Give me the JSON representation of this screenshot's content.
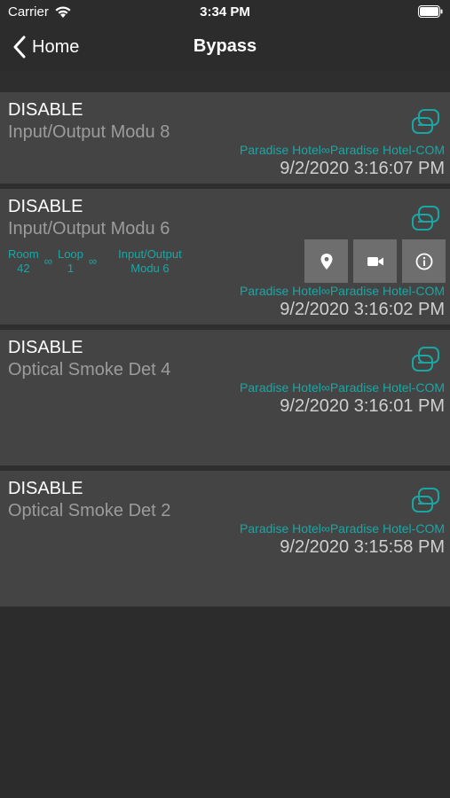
{
  "status_bar": {
    "carrier": "Carrier",
    "time": "3:34 PM"
  },
  "nav": {
    "back_label": "Home",
    "title": "Bypass"
  },
  "items": [
    {
      "status": "DISABLE",
      "device": "Input/Output Modu 8",
      "location": "Paradise Hotel∞Paradise Hotel-COM",
      "timestamp": "9/2/2020 3:16:07 PM"
    },
    {
      "status": "DISABLE",
      "device": "Input/Output Modu 6",
      "location": "Paradise Hotel∞Paradise Hotel-COM",
      "timestamp": "9/2/2020 3:16:02 PM",
      "path": {
        "room_label": "Room",
        "room_value": "42",
        "loop_label": "Loop",
        "loop_value": "1",
        "module_line1": "Input/Output",
        "module_line2": "Modu 6",
        "separator": "∞"
      },
      "actions": [
        "location-pin-icon",
        "video-camera-icon",
        "info-icon"
      ]
    },
    {
      "status": "DISABLE",
      "device": "Optical Smoke Det 4",
      "location": "Paradise Hotel∞Paradise Hotel-COM",
      "timestamp": "9/2/2020 3:16:01 PM"
    },
    {
      "status": "DISABLE",
      "device": "Optical Smoke Det 2",
      "location": "Paradise Hotel∞Paradise Hotel-COM",
      "timestamp": "9/2/2020 3:15:58 PM"
    }
  ],
  "colors": {
    "accent_teal": "#1aa7a4",
    "background": "#2c2c2c",
    "cell": "#444444",
    "action_button": "#6e6e6e"
  }
}
